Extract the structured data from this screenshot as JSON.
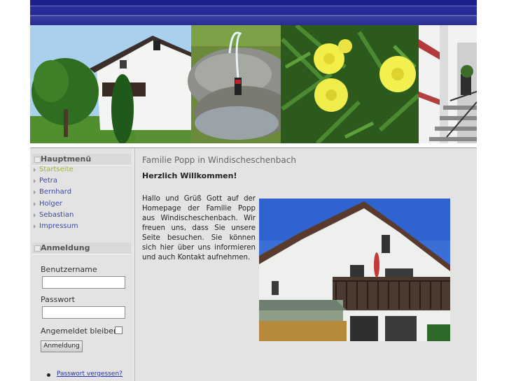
{
  "header": {
    "banner_images": [
      "house-photo",
      "fountain-photo",
      "yellow-flowers-photo",
      "stairs-photo"
    ]
  },
  "sidebar": {
    "main_menu": {
      "title": "Hauptmenü",
      "items": [
        {
          "label": "Startseite",
          "active": true
        },
        {
          "label": "Petra",
          "active": false
        },
        {
          "label": "Bernhard",
          "active": false
        },
        {
          "label": "Holger",
          "active": false
        },
        {
          "label": "Sebastian",
          "active": false
        },
        {
          "label": "Impressum",
          "active": false
        }
      ]
    },
    "login": {
      "title": "Anmeldung",
      "username_label": "Benutzername",
      "username_value": "",
      "password_label": "Passwort",
      "password_value": "",
      "remember_label": "Angemeldet bleiben",
      "remember_checked": false,
      "submit_label": "Anmeldung",
      "forgot_password_link": "Passwort vergessen?"
    }
  },
  "content": {
    "title": "Familie Popp in Windischeschenbach",
    "subtitle": "Herzlich Willkommen!",
    "body": "Hallo und Grüß Gott auf der Homepage der Familie Popp aus Windischeschenbach. Wir freuen uns, dass Sie unsere Seite besuchen. Sie können sich hier über uns informieren und auch Kontakt aufnehmen.",
    "photo": "house-exterior-photo"
  },
  "colors": {
    "header_blue": "#1c1f8c",
    "menu_link": "#3b4aa0",
    "menu_active": "#9ab830",
    "page_background": "#e3e3e3"
  }
}
